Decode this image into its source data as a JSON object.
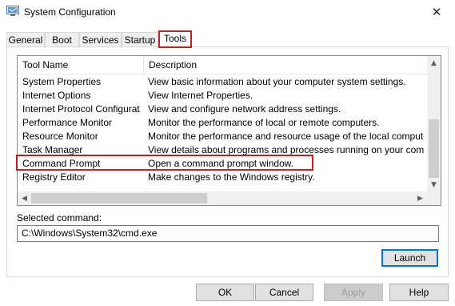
{
  "window": {
    "title": "System Configuration",
    "close_glyph": "✕"
  },
  "tabs": [
    {
      "label": "General"
    },
    {
      "label": "Boot"
    },
    {
      "label": "Services"
    },
    {
      "label": "Startup"
    },
    {
      "label": "Tools",
      "active": true
    }
  ],
  "tools_list": {
    "columns": [
      "Tool Name",
      "Description"
    ],
    "rows": [
      {
        "name": "System Properties",
        "description": "View basic information about your computer system settings."
      },
      {
        "name": "Internet Options",
        "description": "View Internet Properties."
      },
      {
        "name": "Internet Protocol Configurat...",
        "description": "View and configure network address settings."
      },
      {
        "name": "Performance Monitor",
        "description": "Monitor the performance of local or remote computers."
      },
      {
        "name": "Resource Monitor",
        "description": "Monitor the performance and resource usage of the local computer."
      },
      {
        "name": "Task Manager",
        "description": "View details about programs and processes running on your computer."
      },
      {
        "name": "Command Prompt",
        "description": "Open a command prompt window.",
        "selected": true
      },
      {
        "name": "Registry Editor",
        "description": "Make changes to the Windows registry."
      }
    ]
  },
  "selected_command": {
    "label": "Selected command:",
    "value": "C:\\Windows\\System32\\cmd.exe"
  },
  "buttons": {
    "launch": "Launch",
    "ok": "OK",
    "cancel": "Cancel",
    "apply": "Apply",
    "help": "Help"
  },
  "icons": {
    "app": "msconfig-icon",
    "close": "close-icon"
  },
  "colors": {
    "highlight_red": "#d11a1a",
    "focus_blue": "#0078d7"
  }
}
